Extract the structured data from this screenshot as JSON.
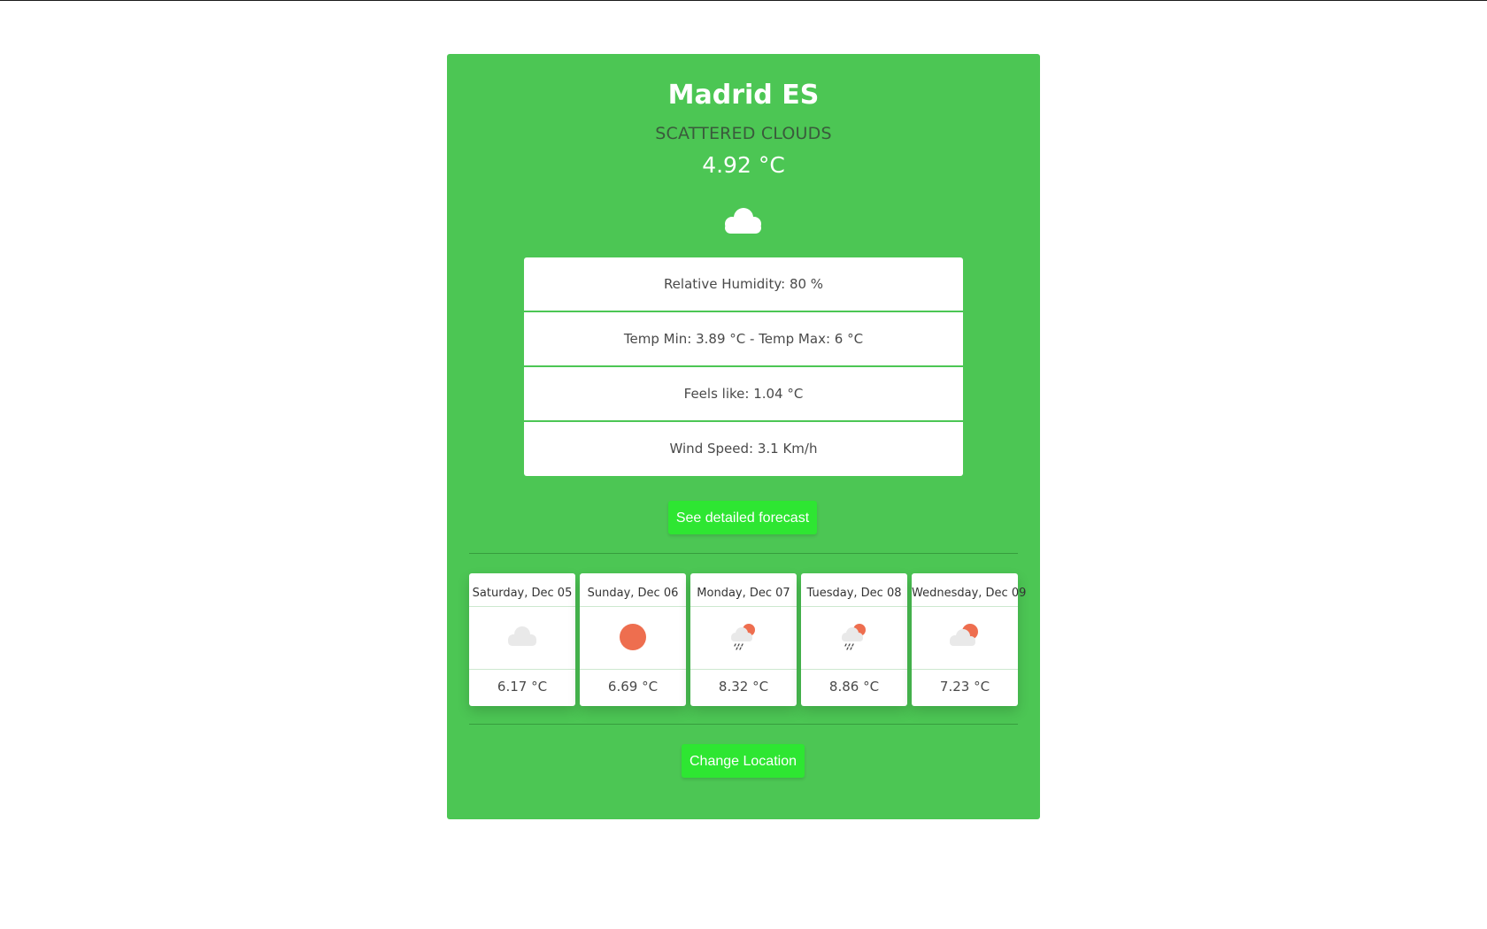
{
  "location": {
    "city": "Madrid ES",
    "description": "SCATTERED CLOUDS",
    "temperature": "4.92 °C",
    "icon": "cloud-icon"
  },
  "details": [
    "Relative Humidity: 80 %",
    "Temp Min: 3.89 °C - Temp Max: 6 °C",
    "Feels like: 1.04 °C",
    "Wind Speed: 3.1 Km/h"
  ],
  "buttons": {
    "forecast_label": "See detailed forecast",
    "change_location_label": "Change Location"
  },
  "forecast": [
    {
      "day": "Saturday, Dec 05",
      "temp": "6.17 °C",
      "icon": "cloud-icon"
    },
    {
      "day": "Sunday, Dec 06",
      "temp": "6.69 °C",
      "icon": "sun-icon"
    },
    {
      "day": "Monday, Dec 07",
      "temp": "8.32 °C",
      "icon": "rain-sun-icon"
    },
    {
      "day": "Tuesday, Dec 08",
      "temp": "8.86 °C",
      "icon": "rain-sun-icon"
    },
    {
      "day": "Wednesday, Dec 09",
      "temp": "7.23 °C",
      "icon": "cloud-sun-icon"
    }
  ],
  "colors": {
    "card_background": "#4cc654",
    "button": "#2ee632",
    "sun": "#ee6e4f",
    "cloud": "#e9e9e9"
  }
}
